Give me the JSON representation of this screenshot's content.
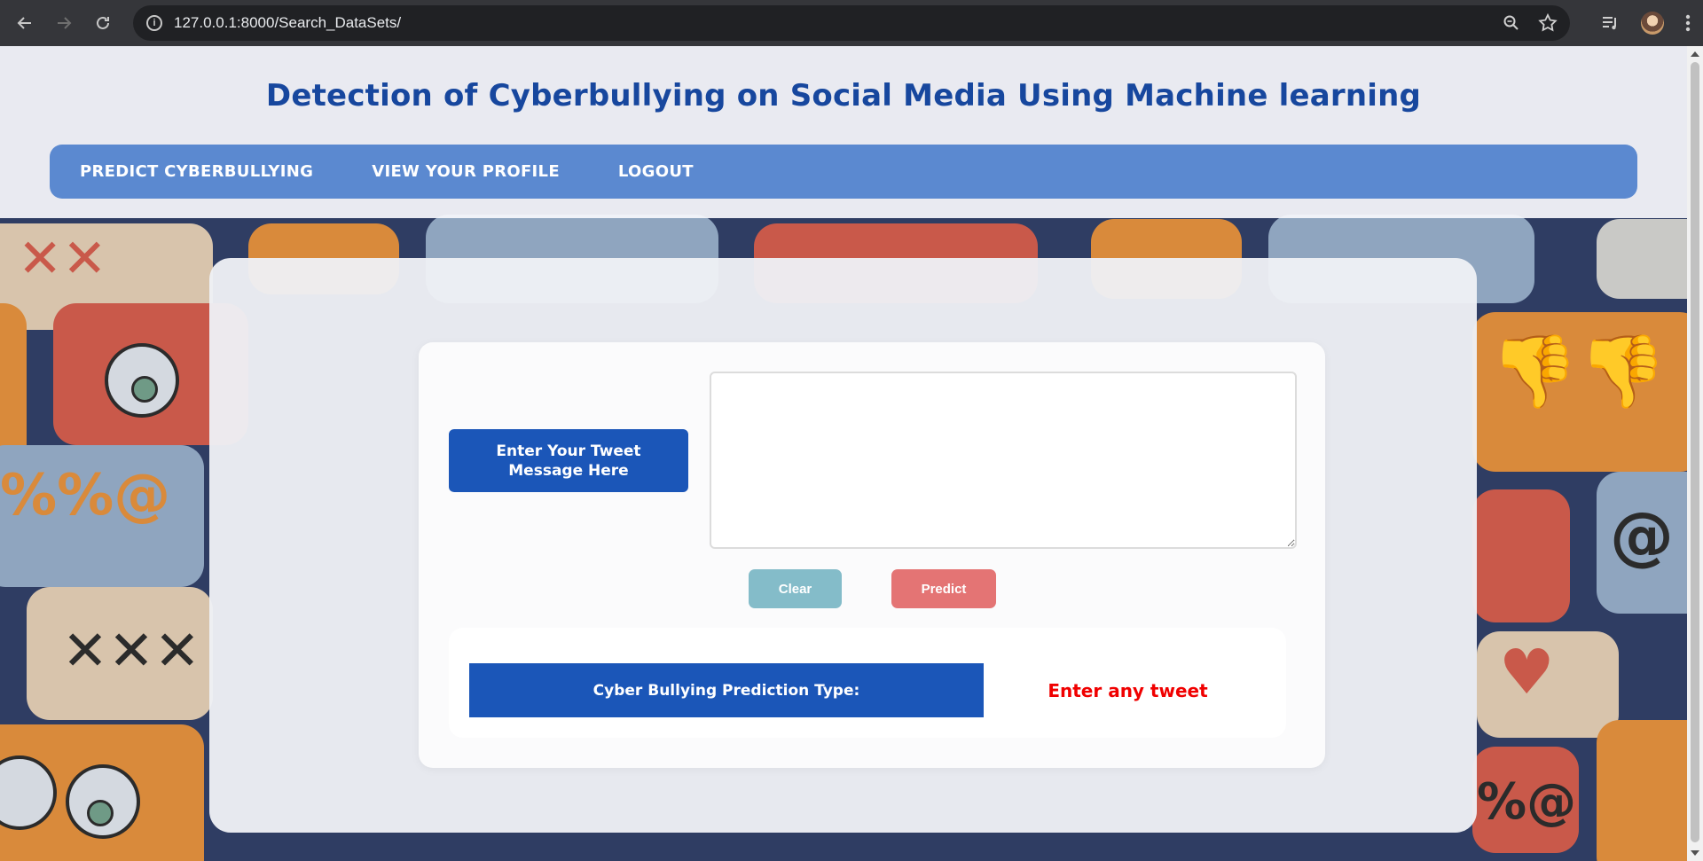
{
  "browser": {
    "url": "127.0.0.1:8000/Search_DataSets/",
    "back_icon": "arrow-left-icon",
    "forward_icon": "arrow-right-icon",
    "reload_icon": "reload-icon",
    "info_icon": "info-icon",
    "zoom_icon": "zoom-icon",
    "bookmark_icon": "star-icon",
    "menu_icon": "kebab-menu-icon"
  },
  "header": {
    "title": "Detection of Cyberbullying on Social Media Using Machine learning",
    "title_color": "#17479e",
    "nav": [
      {
        "label": "PREDICT CYBERBULLYING"
      },
      {
        "label": "VIEW YOUR PROFILE"
      },
      {
        "label": "LOGOUT"
      }
    ],
    "nav_color": "#5b89d0"
  },
  "form": {
    "tweet_label": "Enter Your Tweet Message Here",
    "tweet_value": "",
    "clear_label": "Clear",
    "predict_label": "Predict",
    "result_label": "Cyber Bullying Prediction Type:",
    "result_value": "Enter any tweet",
    "accent_color": "#1b56b8",
    "result_color": "#f00000"
  }
}
